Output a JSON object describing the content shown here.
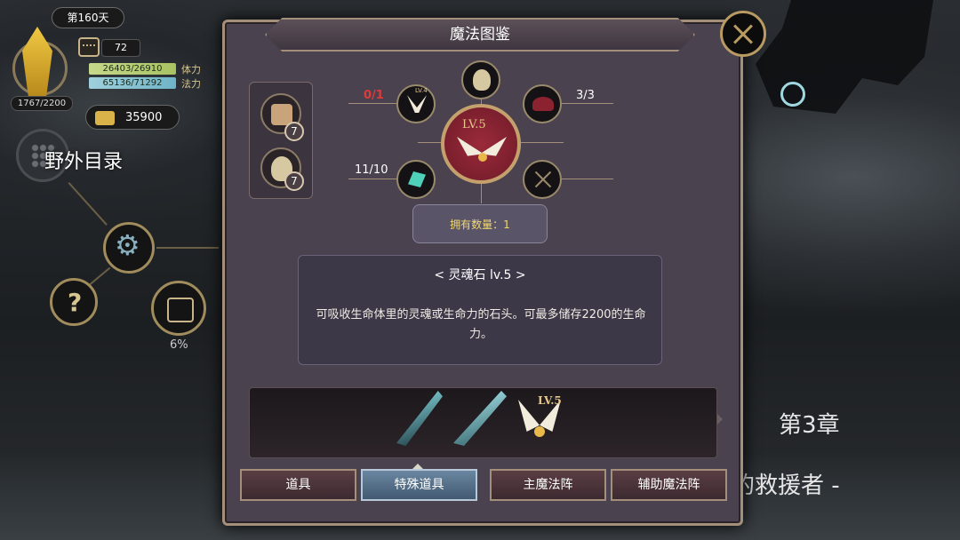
{
  "hud": {
    "day": "第160天",
    "calendar_count": "72",
    "stamina": "26403/26910",
    "stamina_label": "体力",
    "mana": "65136/71292",
    "mana_label": "法力",
    "exp": "1767/2200",
    "gold": "35900",
    "wild_catalog": "野外目录",
    "progress_pct": "6%"
  },
  "background": {
    "chapter": "第3章",
    "rescuer": "的救援者 -"
  },
  "panel": {
    "title": "魔法图鉴",
    "inventory": [
      {
        "icon": "book-icon",
        "count": "7"
      },
      {
        "icon": "pouch-icon",
        "count": "7"
      }
    ],
    "recipe": {
      "center_level": "LV.5",
      "top_left_level": "LV.4",
      "top_left_count": "0/1",
      "top_right_count": "3/3",
      "bottom_left_count": "11/10"
    },
    "owned": "拥有数量：1",
    "item_name": "< 灵魂石 lv.5 >",
    "item_desc": "可吸收生命体里的灵魂或生命力的石头。可最多储存2200的生命力。",
    "strip_level": "LV.5",
    "tabs": [
      "道具",
      "特殊道具",
      "主魔法阵",
      "辅助魔法阵"
    ],
    "active_tab": 1
  }
}
